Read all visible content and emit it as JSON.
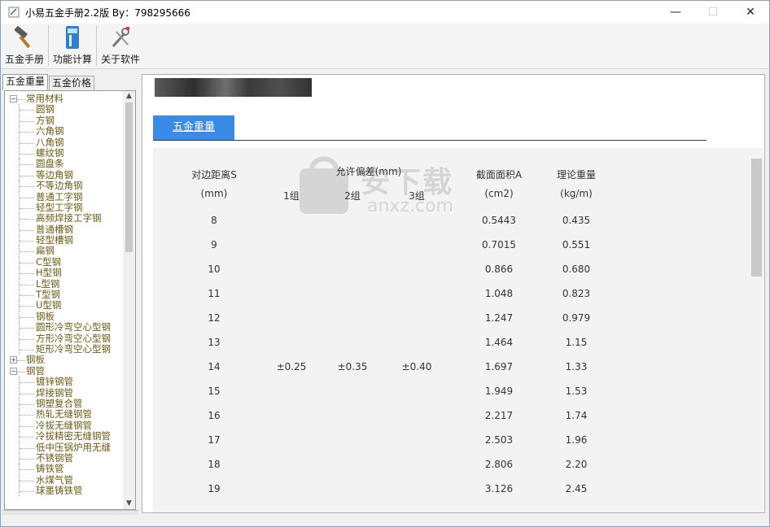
{
  "window": {
    "title": "小易五金手册2.2版 By：798295666",
    "minimize_glyph": "—",
    "maximize_glyph": "☐",
    "close_glyph": "✕"
  },
  "toolbar": {
    "items": [
      {
        "label": "五金手册",
        "icon": "hammer-icon"
      },
      {
        "label": "功能计算",
        "icon": "calculator-icon"
      },
      {
        "label": "关于软件",
        "icon": "tools-icon"
      }
    ]
  },
  "left_tabs": [
    "五金重量",
    "五金价格"
  ],
  "tree": [
    {
      "type": "group",
      "expander": "−",
      "label": "常用材料"
    },
    {
      "type": "leaf",
      "label": "圆钢"
    },
    {
      "type": "leaf",
      "label": "方钢"
    },
    {
      "type": "leaf",
      "label": "六角钢"
    },
    {
      "type": "leaf",
      "label": "八角钢"
    },
    {
      "type": "leaf",
      "label": "螺纹钢"
    },
    {
      "type": "leaf",
      "label": "圆盘条"
    },
    {
      "type": "leaf",
      "label": "等边角钢"
    },
    {
      "type": "leaf",
      "label": "不等边角钢"
    },
    {
      "type": "leaf",
      "label": "普通工字钢"
    },
    {
      "type": "leaf",
      "label": "轻型工字钢"
    },
    {
      "type": "leaf",
      "label": "高频焊接工字钢"
    },
    {
      "type": "leaf",
      "label": "普通槽钢"
    },
    {
      "type": "leaf",
      "label": "轻型槽钢"
    },
    {
      "type": "leaf",
      "label": "扁钢"
    },
    {
      "type": "leaf",
      "label": "C型钢"
    },
    {
      "type": "leaf",
      "label": "H型钢"
    },
    {
      "type": "leaf",
      "label": "L型钢"
    },
    {
      "type": "leaf",
      "label": "T型钢"
    },
    {
      "type": "leaf",
      "label": "U型钢"
    },
    {
      "type": "leaf",
      "label": "钢板"
    },
    {
      "type": "leaf",
      "label": "圆形冷弯空心型钢"
    },
    {
      "type": "leaf",
      "label": "方形冷弯空心型钢"
    },
    {
      "type": "leaf",
      "label": "矩形冷弯空心型钢"
    },
    {
      "type": "group",
      "expander": "+",
      "label": "钢板"
    },
    {
      "type": "group",
      "expander": "−",
      "label": "钢管"
    },
    {
      "type": "leaf",
      "label": "镀锌钢管"
    },
    {
      "type": "leaf",
      "label": "焊接钢管"
    },
    {
      "type": "leaf",
      "label": "钢塑复合管"
    },
    {
      "type": "leaf",
      "label": "热轧无缝钢管"
    },
    {
      "type": "leaf",
      "label": "冷拔无缝钢管"
    },
    {
      "type": "leaf",
      "label": "冷拔精密无缝钢管"
    },
    {
      "type": "leaf",
      "label": "低中压锅炉用无缝"
    },
    {
      "type": "leaf",
      "label": "不锈钢管"
    },
    {
      "type": "leaf",
      "label": "铸铁管"
    },
    {
      "type": "leaf",
      "label": "水煤气管"
    },
    {
      "type": "leaf",
      "label": "球墨铸铁管"
    }
  ],
  "content": {
    "tab_label": "五金重量",
    "headers": {
      "s": "对边距离S",
      "s_unit": "(mm)",
      "tol": "允许偏差(mm)",
      "g1": "1组",
      "g2": "2组",
      "g3": "3组",
      "area": "截面面积A",
      "area_unit": "(cm2)",
      "weight": "理论重量",
      "weight_unit": "(kg/m)"
    },
    "rows": [
      {
        "s": "8",
        "g1": "",
        "g2": "",
        "g3": "",
        "area": "0.5443",
        "weight": "0.435"
      },
      {
        "s": "9",
        "g1": "",
        "g2": "",
        "g3": "",
        "area": "0.7015",
        "weight": "0.551"
      },
      {
        "s": "10",
        "g1": "",
        "g2": "",
        "g3": "",
        "area": "0.866",
        "weight": "0.680"
      },
      {
        "s": "11",
        "g1": "",
        "g2": "",
        "g3": "",
        "area": "1.048",
        "weight": "0.823"
      },
      {
        "s": "12",
        "g1": "",
        "g2": "",
        "g3": "",
        "area": "1.247",
        "weight": "0.979"
      },
      {
        "s": "13",
        "g1": "",
        "g2": "",
        "g3": "",
        "area": "1.464",
        "weight": "1.15"
      },
      {
        "s": "14",
        "g1": "±0.25",
        "g2": "±0.35",
        "g3": "±0.40",
        "area": "1.697",
        "weight": "1.33"
      },
      {
        "s": "15",
        "g1": "",
        "g2": "",
        "g3": "",
        "area": "1.949",
        "weight": "1.53"
      },
      {
        "s": "16",
        "g1": "",
        "g2": "",
        "g3": "",
        "area": "2.217",
        "weight": "1.74"
      },
      {
        "s": "17",
        "g1": "",
        "g2": "",
        "g3": "",
        "area": "2.503",
        "weight": "1.96"
      },
      {
        "s": "18",
        "g1": "",
        "g2": "",
        "g3": "",
        "area": "2.806",
        "weight": "2.20"
      },
      {
        "s": "19",
        "g1": "",
        "g2": "",
        "g3": "",
        "area": "3.126",
        "weight": "2.45"
      }
    ]
  },
  "watermark": {
    "text": "安下载",
    "sub": "anxz.com"
  },
  "colors": {
    "accent": "#3a8be8",
    "tree_text": "#6b5a12"
  }
}
